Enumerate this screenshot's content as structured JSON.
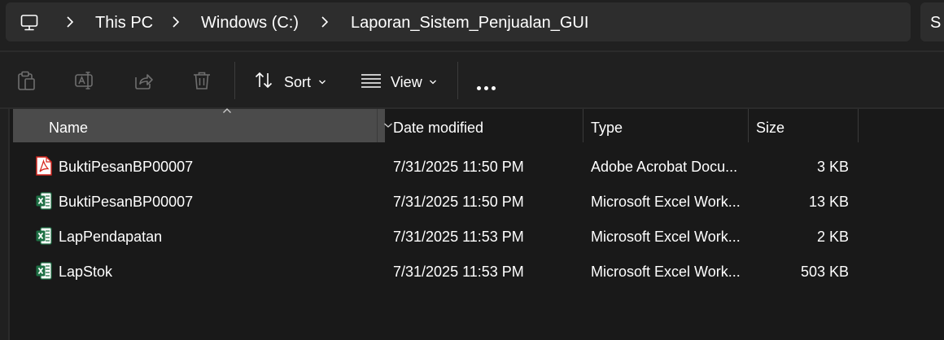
{
  "breadcrumb": {
    "root_icon": "this-pc-icon",
    "items": [
      "This PC",
      "Windows (C:)",
      "Laporan_Sistem_Penjualan_GUI"
    ]
  },
  "search": {
    "partial_text": "S"
  },
  "toolbar": {
    "icons": [
      "paste-icon",
      "rename-icon",
      "share-icon",
      "delete-icon"
    ],
    "sort_label": "Sort",
    "view_label": "View",
    "more_icon": "more-options-icon"
  },
  "columns": {
    "name": "Name",
    "date": "Date modified",
    "type": "Type",
    "size": "Size"
  },
  "files": [
    {
      "icon": "pdf-file-icon",
      "name": "BuktiPesanBP00007",
      "date": "7/31/2025 11:50 PM",
      "type": "Adobe Acrobat Docu...",
      "size": "3 KB"
    },
    {
      "icon": "excel-file-icon",
      "name": "BuktiPesanBP00007",
      "date": "7/31/2025 11:50 PM",
      "type": "Microsoft Excel Work...",
      "size": "13 KB"
    },
    {
      "icon": "excel-file-icon",
      "name": "LapPendapatan",
      "date": "7/31/2025 11:53 PM",
      "type": "Microsoft Excel Work...",
      "size": "2 KB"
    },
    {
      "icon": "excel-file-icon",
      "name": "LapStok",
      "date": "7/31/2025 11:53 PM",
      "type": "Microsoft Excel Work...",
      "size": "503 KB"
    }
  ],
  "colors": {
    "background": "#191919",
    "bar": "#202020",
    "address_field": "#2d2d2d",
    "selected_header": "#4b4b4b",
    "pdf_red": "#d7261e",
    "excel_green": "#1d7044"
  }
}
